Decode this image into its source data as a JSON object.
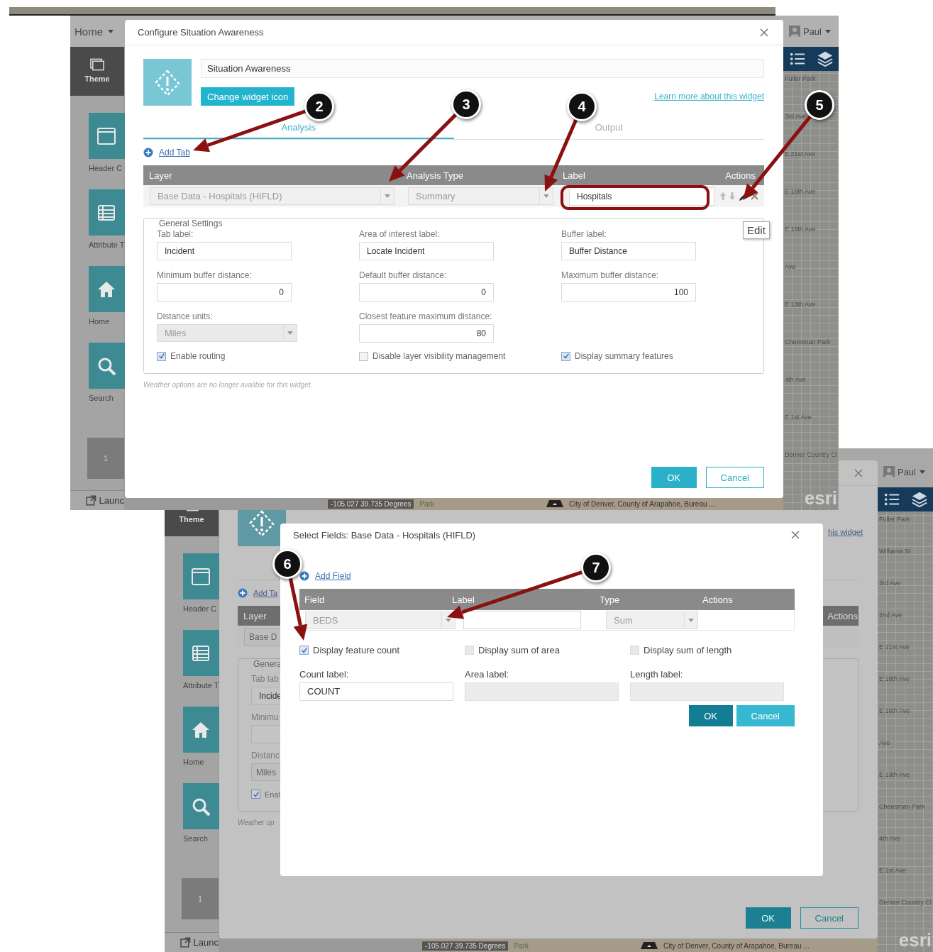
{
  "screenshot_1": {
    "header": {
      "menu": "Home",
      "user": "Paul"
    },
    "sidebar": [
      {
        "label": "Theme",
        "selected": true
      },
      {
        "label": "Header C",
        "selected": false
      },
      {
        "label": "Attribute T",
        "selected": false
      },
      {
        "label": "Home",
        "selected": false
      },
      {
        "label": "Search",
        "selected": false
      }
    ],
    "page_number": "1",
    "launch": "Launc",
    "map_labels": [
      "Fuller Park",
      "3rd Ave",
      "E 21st Ave",
      "E 18th Ave",
      "E 16th Ave",
      "Ave",
      "E 13th Ave",
      "Cheesman Park",
      "4th Ave",
      "E 1st Ave",
      "Denver Country Cl"
    ],
    "map_logo": "esri",
    "status_bar": {
      "coordinates": "-105.027 39.735 Degrees",
      "place": "Park",
      "attribution": "City of Denver, County of Arapahoe, Bureau ..."
    },
    "dialog": {
      "title": "Configure Situation Awareness",
      "widget_name": "Situation Awareness",
      "change_icon_button": "Change widget icon",
      "learn_more_link": "Learn more about this widget",
      "tabs": [
        {
          "label": "Analysis",
          "selected": true
        },
        {
          "label": "Output",
          "selected": false
        }
      ],
      "add_tab": "Add Tab",
      "table": {
        "columns": [
          "Layer",
          "Analysis Type",
          "Label",
          "Actions"
        ],
        "rows": [
          {
            "layer": "Base Data - Hospitals (HIFLD)",
            "analysis_type": "Summary",
            "label": "Hospitals"
          }
        ]
      },
      "tooltip": "Edit",
      "general_settings": {
        "title": "General Settings",
        "fields": [
          {
            "label": "Tab label:",
            "value": "Incident",
            "kind": "text"
          },
          {
            "label": "Area of interest label:",
            "value": "Locate Incident",
            "kind": "text"
          },
          {
            "label": "Buffer label:",
            "value": "Buffer Distance",
            "kind": "text"
          },
          {
            "label": "Minimum buffer distance:",
            "value": "0",
            "kind": "number"
          },
          {
            "label": "Default buffer distance:",
            "value": "0",
            "kind": "number"
          },
          {
            "label": "Maximum buffer distance:",
            "value": "100",
            "kind": "number"
          },
          {
            "label": "Distance units:",
            "value": "Miles",
            "kind": "select"
          },
          {
            "label": "Closest feature maximum distance:",
            "value": "80",
            "kind": "number"
          }
        ],
        "checkboxes": [
          {
            "label": "Enable routing",
            "checked": true
          },
          {
            "label": "Disable layer visibility management",
            "checked": false
          },
          {
            "label": "Display summary features",
            "checked": true
          }
        ]
      },
      "note": "Weather options are no longer avalible for this widget.",
      "buttons": [
        {
          "label": "OK",
          "kind": "primary"
        },
        {
          "label": "Cancel",
          "kind": "secondary"
        }
      ]
    }
  },
  "screenshot_2": {
    "header": {
      "user": "Paul"
    },
    "sidebar": [
      {
        "label": "Theme",
        "selected": true
      },
      {
        "label": "Header C",
        "selected": false
      },
      {
        "label": "Attribute T",
        "selected": false
      },
      {
        "label": "Home",
        "selected": false
      },
      {
        "label": "Search",
        "selected": false
      }
    ],
    "page_number": "1",
    "launch": "Launc",
    "map_labels": [
      "Fuller Park",
      "Williams St",
      "3rd Ave",
      "2nd Ave",
      "E 21st Ave",
      "E 18th Ave",
      "E 16th Ave",
      "Ave",
      "E 13th Ave",
      "Cheesman Park",
      "4th Ave",
      "E 1st Ave",
      "Denver Country Cl"
    ],
    "map_logo": "esri",
    "status_bar": {
      "coordinates": "-105.027 39.735 Degrees",
      "place": "Park",
      "attribution": "City of Denver, County of Arapahoe, Bureau ..."
    },
    "background_dialog": {
      "learn_more_link": "his widget",
      "add_tab": "Add Ta",
      "table_columns": [
        "Layer",
        "Actions"
      ],
      "layer": "Base D",
      "fieldset_title": "Genera",
      "fields": [
        {
          "label": "Tab lab",
          "value": "Incide",
          "kind": "text"
        },
        {
          "label": "Minimu",
          "kind": "number"
        },
        {
          "label": "Distanc",
          "value": "Miles",
          "kind": "select"
        }
      ],
      "checkbox": {
        "label": "Enal",
        "checked": true
      },
      "note": "Weather op",
      "buttons": [
        {
          "label": "OK",
          "kind": "primary"
        },
        {
          "label": "Cancel",
          "kind": "secondary"
        }
      ]
    },
    "dialog": {
      "title": "Select Fields: Base Data - Hospitals (HIFLD)",
      "add_field": "Add Field",
      "table": {
        "columns": [
          "Field",
          "Label",
          "Type",
          "Actions"
        ],
        "rows": [
          {
            "field": "BEDS",
            "type": "Sum"
          }
        ]
      },
      "checkboxes": [
        {
          "label": "Display feature count",
          "checked": true,
          "disabled": false
        },
        {
          "label": "Display sum of area",
          "checked": false,
          "disabled": true
        },
        {
          "label": "Display sum of length",
          "checked": false,
          "disabled": true
        }
      ],
      "fields": [
        {
          "label": "Count label:",
          "value": "COUNT",
          "disabled": false
        },
        {
          "label": "Area label:",
          "disabled": true
        },
        {
          "label": "Length label:",
          "disabled": true
        }
      ],
      "buttons": [
        {
          "label": "OK",
          "kind": "primary"
        },
        {
          "label": "Cancel",
          "kind": "secondary"
        }
      ]
    }
  },
  "annotations": [
    {
      "number": "2"
    },
    {
      "number": "3"
    },
    {
      "number": "4"
    },
    {
      "number": "5"
    },
    {
      "number": "6"
    },
    {
      "number": "7"
    }
  ]
}
